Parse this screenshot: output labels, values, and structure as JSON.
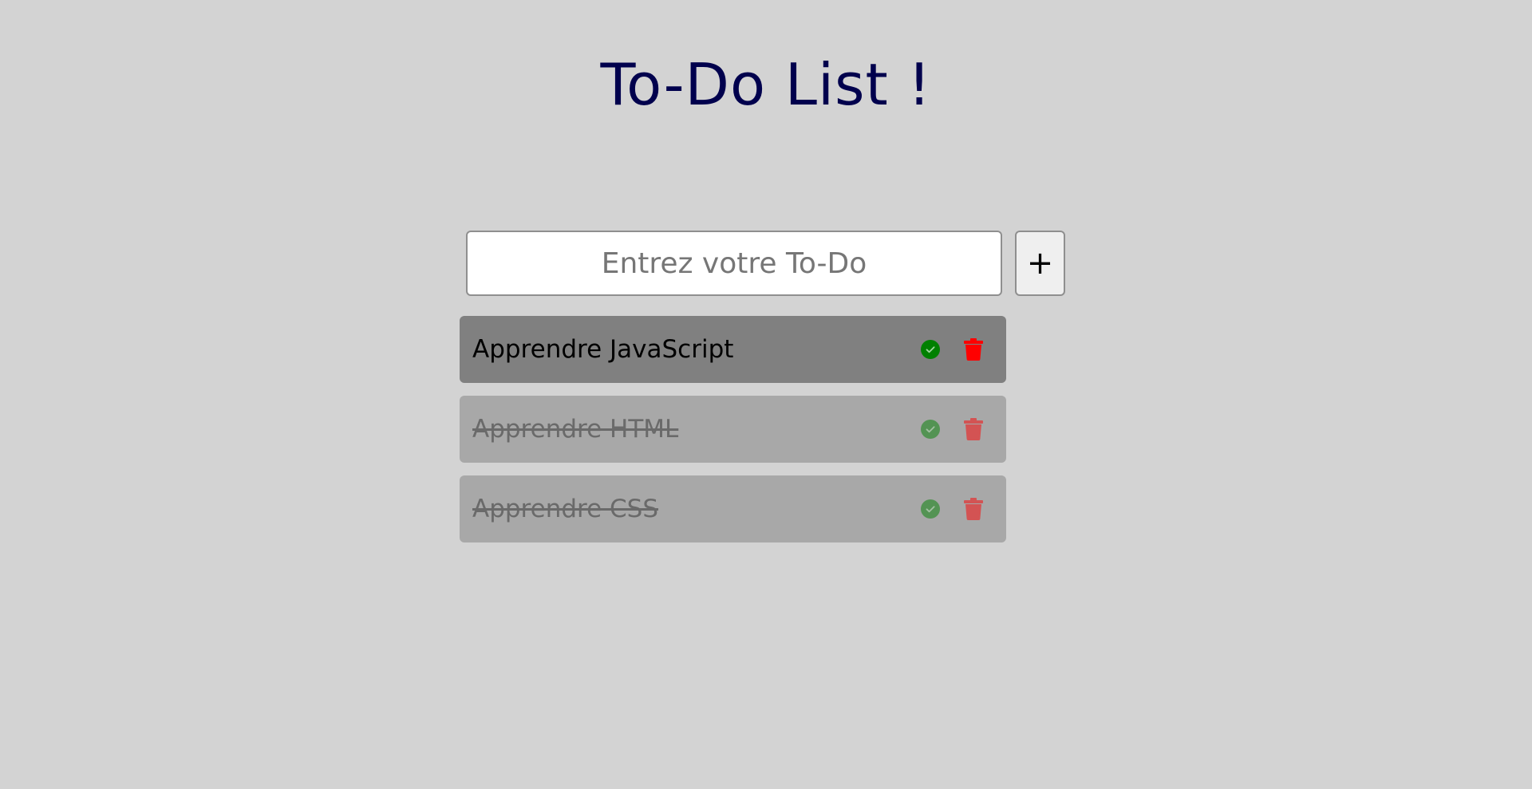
{
  "header": {
    "title": "To-Do List !"
  },
  "form": {
    "input_placeholder": "Entrez votre To-Do",
    "input_value": "",
    "add_button_label": "+"
  },
  "todos": [
    {
      "label": "Apprendre JavaScript",
      "completed": false
    },
    {
      "label": "Apprendre HTML",
      "completed": true
    },
    {
      "label": "Apprendre CSS",
      "completed": true
    }
  ],
  "icons": {
    "complete": "check-circle-icon",
    "delete": "trash-icon"
  },
  "colors": {
    "background": "#d3d3d3",
    "title": "#00004d",
    "item_active": "#808080",
    "item_done": "#a8a8a8",
    "check": "#008000",
    "trash": "#ff0000"
  }
}
